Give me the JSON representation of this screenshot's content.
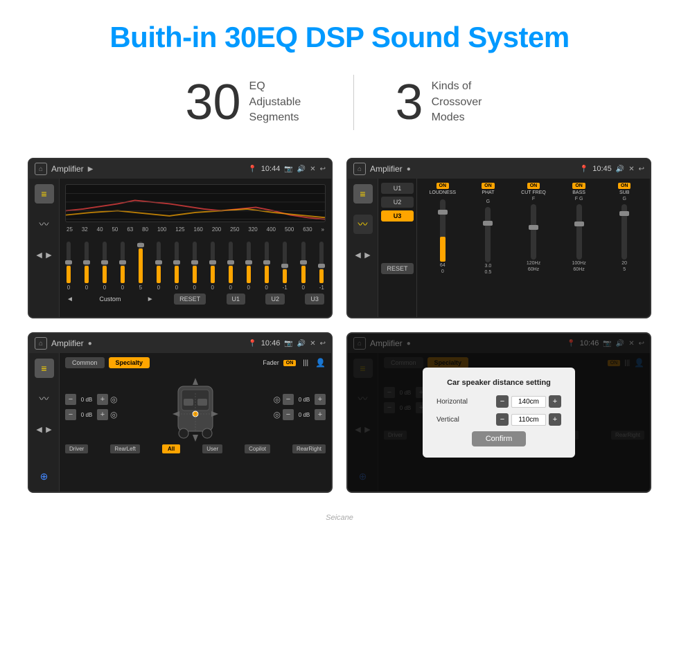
{
  "header": {
    "title": "Buith-in 30EQ DSP Sound System"
  },
  "stats": [
    {
      "number": "30",
      "label": "EQ Adjustable\nSegments"
    },
    {
      "number": "3",
      "label": "Kinds of\nCrossover Modes"
    }
  ],
  "screens": [
    {
      "id": "screen1",
      "topbar": {
        "title": "Amplifier",
        "time": "10:44"
      },
      "type": "eq"
    },
    {
      "id": "screen2",
      "topbar": {
        "title": "Amplifier",
        "time": "10:45"
      },
      "type": "crossover"
    },
    {
      "id": "screen3",
      "topbar": {
        "title": "Amplifier",
        "time": "10:46"
      },
      "type": "specialty"
    },
    {
      "id": "screen4",
      "topbar": {
        "title": "Amplifier",
        "time": "10:46"
      },
      "type": "specialty-dialog"
    }
  ],
  "eq": {
    "frequencies": [
      "25",
      "32",
      "40",
      "50",
      "63",
      "80",
      "100",
      "125",
      "160",
      "200",
      "250",
      "320",
      "400",
      "500",
      "630"
    ],
    "values": [
      "0",
      "0",
      "0",
      "0",
      "5",
      "0",
      "0",
      "0",
      "0",
      "0",
      "0",
      "0",
      "-1",
      "0",
      "-1"
    ],
    "preset": "Custom",
    "buttons": [
      "RESET",
      "U1",
      "U2",
      "U3"
    ],
    "presets": [
      "U1",
      "U2",
      "U3"
    ]
  },
  "crossover": {
    "channels": [
      "U1",
      "U2",
      "U3"
    ],
    "sections": [
      {
        "name": "LOUDNESS",
        "toggle": "ON"
      },
      {
        "name": "PHAT",
        "toggle": "ON"
      },
      {
        "name": "CUT FREQ",
        "toggle": "ON"
      },
      {
        "name": "BASS",
        "toggle": "ON"
      },
      {
        "name": "SUB",
        "toggle": "ON"
      }
    ]
  },
  "specialty": {
    "buttons": [
      "Common",
      "Specialty"
    ],
    "active": "Specialty",
    "fader": {
      "label": "Fader",
      "toggle": "ON"
    },
    "controls": [
      {
        "label": "0 dB"
      },
      {
        "label": "0 dB"
      },
      {
        "label": "0 dB"
      },
      {
        "label": "0 dB"
      }
    ],
    "speaker_labels": [
      "Driver",
      "RearLeft",
      "All",
      "User",
      "Copilot",
      "RearRight"
    ]
  },
  "dialog": {
    "title": "Car speaker distance setting",
    "rows": [
      {
        "label": "Horizontal",
        "value": "140cm"
      },
      {
        "label": "Vertical",
        "value": "110cm"
      }
    ],
    "confirm_label": "Confirm"
  },
  "watermark": "Seicane"
}
